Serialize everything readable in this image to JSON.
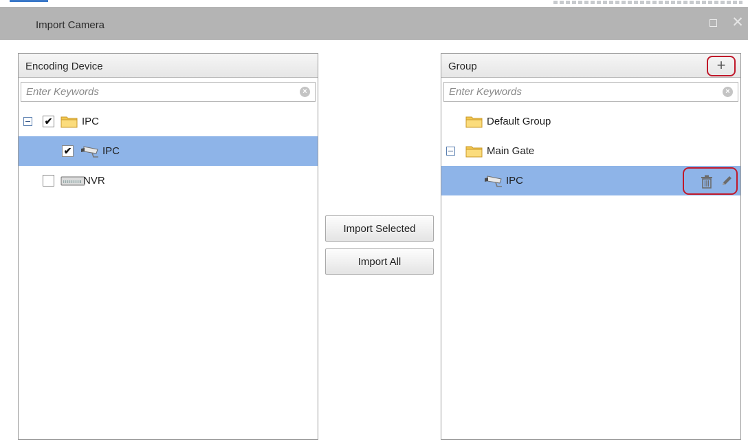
{
  "dialog": {
    "title": "Import Camera",
    "maximize_icon": "maximize-icon",
    "close_glyph": "✕"
  },
  "left_panel": {
    "header": "Encoding Device",
    "search_placeholder": "Enter Keywords",
    "tree": [
      {
        "label": "IPC",
        "type": "folder",
        "expanded": true,
        "checked": true
      },
      {
        "label": "IPC",
        "type": "camera",
        "checked": true,
        "selected": true
      },
      {
        "label": "NVR",
        "type": "nvr",
        "checked": false
      }
    ]
  },
  "right_panel": {
    "header": "Group",
    "add_glyph": "+",
    "search_placeholder": "Enter Keywords",
    "tree": [
      {
        "label": "Default Group",
        "type": "folder"
      },
      {
        "label": "Main Gate",
        "type": "folder",
        "expanded": true
      },
      {
        "label": "IPC",
        "type": "camera",
        "selected": true
      }
    ]
  },
  "buttons": {
    "import_selected": "Import Selected",
    "import_all": "Import All"
  },
  "colors": {
    "title_bar": "#b4b4b4",
    "selection": "#8eb4e8",
    "highlight_outline": "#c0182a",
    "folder": "#f2c750"
  },
  "icons": {
    "folder": "folder-icon",
    "camera": "camera-icon",
    "nvr": "nvr-icon",
    "clear": "clear-search-icon",
    "trash": "trash-icon",
    "edit": "pencil-icon"
  }
}
